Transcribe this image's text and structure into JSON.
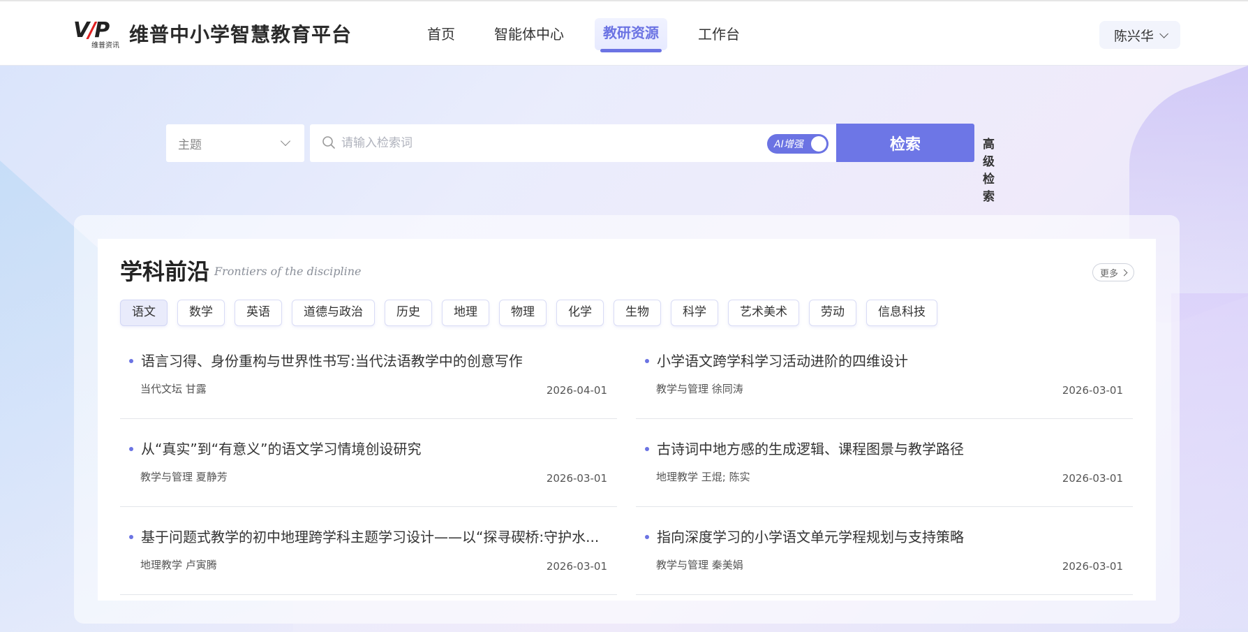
{
  "header": {
    "logo_mark": "VIP",
    "logo_sub": "维普资讯",
    "app_title": "维普中小学智慧教育平台",
    "nav": [
      {
        "label": "首页",
        "active": false
      },
      {
        "label": "智能体中心",
        "active": false
      },
      {
        "label": "教研资源",
        "active": true
      },
      {
        "label": "工作台",
        "active": false
      }
    ],
    "user_name": "陈兴华"
  },
  "search": {
    "topic_label": "主题",
    "placeholder": "请输入检索词",
    "value": "",
    "ai_toggle_label": "AI增强",
    "ai_enabled": true,
    "button_label": "检索",
    "advanced_label": "高级检索"
  },
  "frontiers": {
    "title": "学科前沿",
    "subtitle": "Frontiers of the discipline",
    "more_label": "更多",
    "subjects": [
      {
        "label": "语文",
        "active": true
      },
      {
        "label": "数学",
        "active": false
      },
      {
        "label": "英语",
        "active": false
      },
      {
        "label": "道德与政治",
        "active": false
      },
      {
        "label": "历史",
        "active": false
      },
      {
        "label": "地理",
        "active": false
      },
      {
        "label": "物理",
        "active": false
      },
      {
        "label": "化学",
        "active": false
      },
      {
        "label": "生物",
        "active": false
      },
      {
        "label": "科学",
        "active": false
      },
      {
        "label": "艺术美术",
        "active": false
      },
      {
        "label": "劳动",
        "active": false
      },
      {
        "label": "信息科技",
        "active": false
      }
    ],
    "articles": [
      {
        "title": "语言习得、身份重构与世界性书写:当代法语教学中的创意写作",
        "source": "当代文坛 甘露",
        "date": "2026-04-01"
      },
      {
        "title": "小学语文跨学科学习活动进阶的四维设计",
        "source": "教学与管理 徐同涛",
        "date": "2026-03-01"
      },
      {
        "title": "从“真实”到“有意义”的语文学习情境创设研究",
        "source": "教学与管理 夏静芳",
        "date": "2026-03-01"
      },
      {
        "title": "古诗词中地方感的生成逻辑、课程图景与教学路径",
        "source": "地理教学 王焜; 陈实",
        "date": "2026-03-01"
      },
      {
        "title": "基于问题式教学的初中地理跨学科主题学习设计——以“探寻碶桥:守护水...",
        "source": "地理教学 卢寅腾",
        "date": "2026-03-01"
      },
      {
        "title": "指向深度学习的小学语文单元学程规划与支持策略",
        "source": "教学与管理 秦美娟",
        "date": "2026-03-01"
      }
    ]
  },
  "colors": {
    "accent": "#6b73e3",
    "search_button": "#6d76e6",
    "logo_red": "#e02020"
  },
  "icons": {
    "search": "search-icon",
    "user_dropdown": "chevron-down-icon",
    "topic_dropdown": "chevron-down-icon",
    "more": "chevron-right-icon",
    "bullet": "bullet-dot-icon"
  }
}
